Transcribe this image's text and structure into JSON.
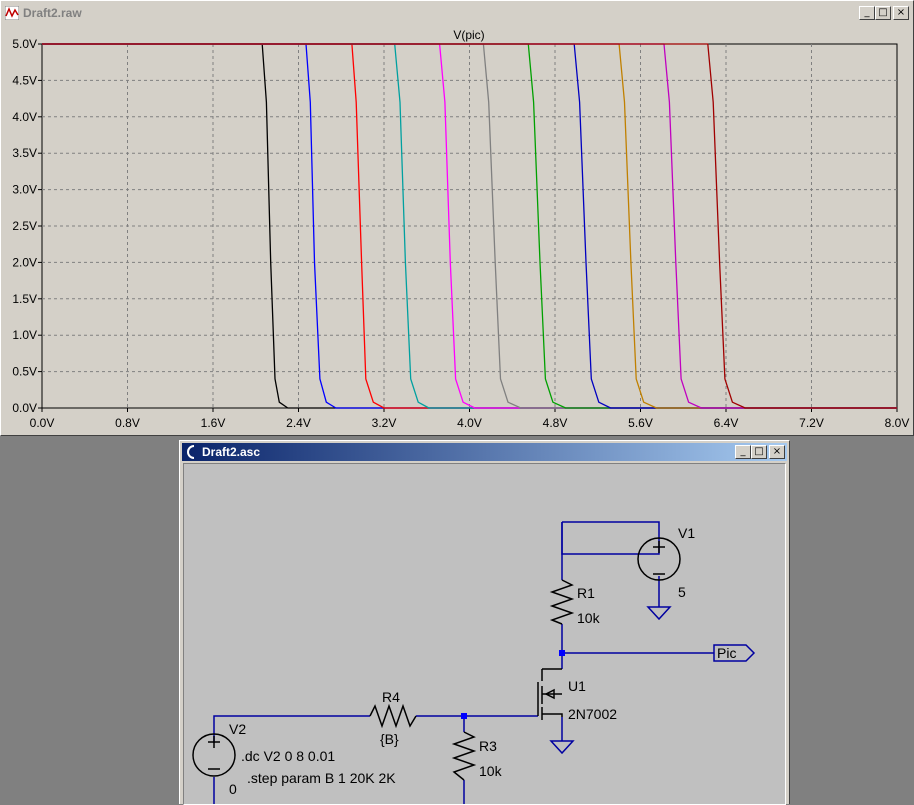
{
  "plot_window": {
    "title": "Draft2.raw",
    "trace_label": "V(pic)",
    "controls": {
      "minimize": "_",
      "maximize": "□",
      "close": "×"
    }
  },
  "schematic_window": {
    "title": "Draft2.asc",
    "controls": {
      "minimize": "_",
      "maximize": "□",
      "close": "×"
    },
    "components": {
      "v1_name": "V1",
      "v1_value": "5",
      "r1_name": "R1",
      "r1_value": "10k",
      "u1_name": "U1",
      "u1_value": "2N7002",
      "r4_name": "R4",
      "r4_value": "{B}",
      "r3_name": "R3",
      "r3_value": "10k",
      "v2_name": "V2",
      "v2_value": "0",
      "net_label": "Pic",
      "directive_dc": ".dc V2 0 8 0.01",
      "directive_step": ".step param B 1 20K 2K"
    }
  },
  "colors": {
    "plot_bg": "#d4d0c8",
    "grid": "#808080",
    "wire": "#0000a0",
    "junction": "#0000ff"
  },
  "chart_data": {
    "type": "line",
    "title": "V(pic)",
    "xlabel": "",
    "ylabel": "",
    "xlim": [
      0,
      8
    ],
    "ylim": [
      0,
      5
    ],
    "x_ticks": [
      "0.0V",
      "0.8V",
      "1.6V",
      "2.4V",
      "3.2V",
      "4.0V",
      "4.8V",
      "5.6V",
      "6.4V",
      "7.2V",
      "8.0V"
    ],
    "y_ticks": [
      "0.0V",
      "0.5V",
      "1.0V",
      "1.5V",
      "2.0V",
      "2.5V",
      "3.0V",
      "3.5V",
      "4.0V",
      "4.5V",
      "5.0V"
    ],
    "grid": true,
    "series": [
      {
        "color": "#000000",
        "high_v": 5.0,
        "x": [
          0,
          2.06,
          2.1,
          2.14,
          2.18,
          2.22,
          2.3,
          8.0
        ],
        "y": [
          5.0,
          5.0,
          4.2,
          2.0,
          0.4,
          0.08,
          0.0,
          0.0
        ]
      },
      {
        "color": "#0000ff",
        "x": [
          0,
          2.47,
          2.51,
          2.55,
          2.6,
          2.66,
          2.75,
          8.0
        ],
        "y": [
          5.0,
          5.0,
          4.2,
          2.0,
          0.4,
          0.08,
          0.0,
          0.0
        ]
      },
      {
        "color": "#ff0000",
        "x": [
          0,
          2.9,
          2.94,
          2.99,
          3.03,
          3.1,
          3.2,
          8.0
        ],
        "y": [
          5.0,
          5.0,
          4.2,
          2.0,
          0.4,
          0.08,
          0.0,
          0.0
        ]
      },
      {
        "color": "#00a0a0",
        "x": [
          0,
          3.3,
          3.35,
          3.4,
          3.45,
          3.52,
          3.62,
          8.0
        ],
        "y": [
          5.0,
          5.0,
          4.2,
          2.0,
          0.4,
          0.08,
          0.0,
          0.0
        ]
      },
      {
        "color": "#ff00ff",
        "x": [
          0,
          3.72,
          3.77,
          3.82,
          3.87,
          3.94,
          4.05,
          8.0
        ],
        "y": [
          5.0,
          5.0,
          4.2,
          2.0,
          0.4,
          0.08,
          0.0,
          0.0
        ]
      },
      {
        "color": "#808080",
        "x": [
          0,
          4.13,
          4.18,
          4.24,
          4.29,
          4.36,
          4.48,
          8.0
        ],
        "y": [
          5.0,
          5.0,
          4.2,
          2.0,
          0.4,
          0.08,
          0.0,
          0.0
        ]
      },
      {
        "color": "#00a000",
        "x": [
          0,
          4.55,
          4.6,
          4.66,
          4.71,
          4.78,
          4.9,
          8.0
        ],
        "y": [
          5.0,
          5.0,
          4.2,
          2.0,
          0.4,
          0.08,
          0.0,
          0.0
        ]
      },
      {
        "color": "#0000c0",
        "x": [
          0,
          4.98,
          5.03,
          5.09,
          5.14,
          5.21,
          5.32,
          8.0
        ],
        "y": [
          5.0,
          5.0,
          4.2,
          2.0,
          0.4,
          0.08,
          0.0,
          0.0
        ]
      },
      {
        "color": "#c08000",
        "x": [
          0,
          5.4,
          5.45,
          5.51,
          5.56,
          5.63,
          5.75,
          8.0
        ],
        "y": [
          5.0,
          5.0,
          4.2,
          2.0,
          0.4,
          0.08,
          0.0,
          0.0
        ]
      },
      {
        "color": "#c000c0",
        "x": [
          0,
          5.82,
          5.87,
          5.93,
          5.98,
          6.05,
          6.17,
          8.0
        ],
        "y": [
          5.0,
          5.0,
          4.2,
          2.0,
          0.4,
          0.08,
          0.0,
          0.0
        ]
      },
      {
        "color": "#a00000",
        "x": [
          0,
          6.23,
          6.28,
          6.34,
          6.39,
          6.46,
          6.58,
          8.0
        ],
        "y": [
          5.0,
          5.0,
          4.2,
          2.0,
          0.4,
          0.08,
          0.0,
          0.0
        ]
      }
    ]
  }
}
